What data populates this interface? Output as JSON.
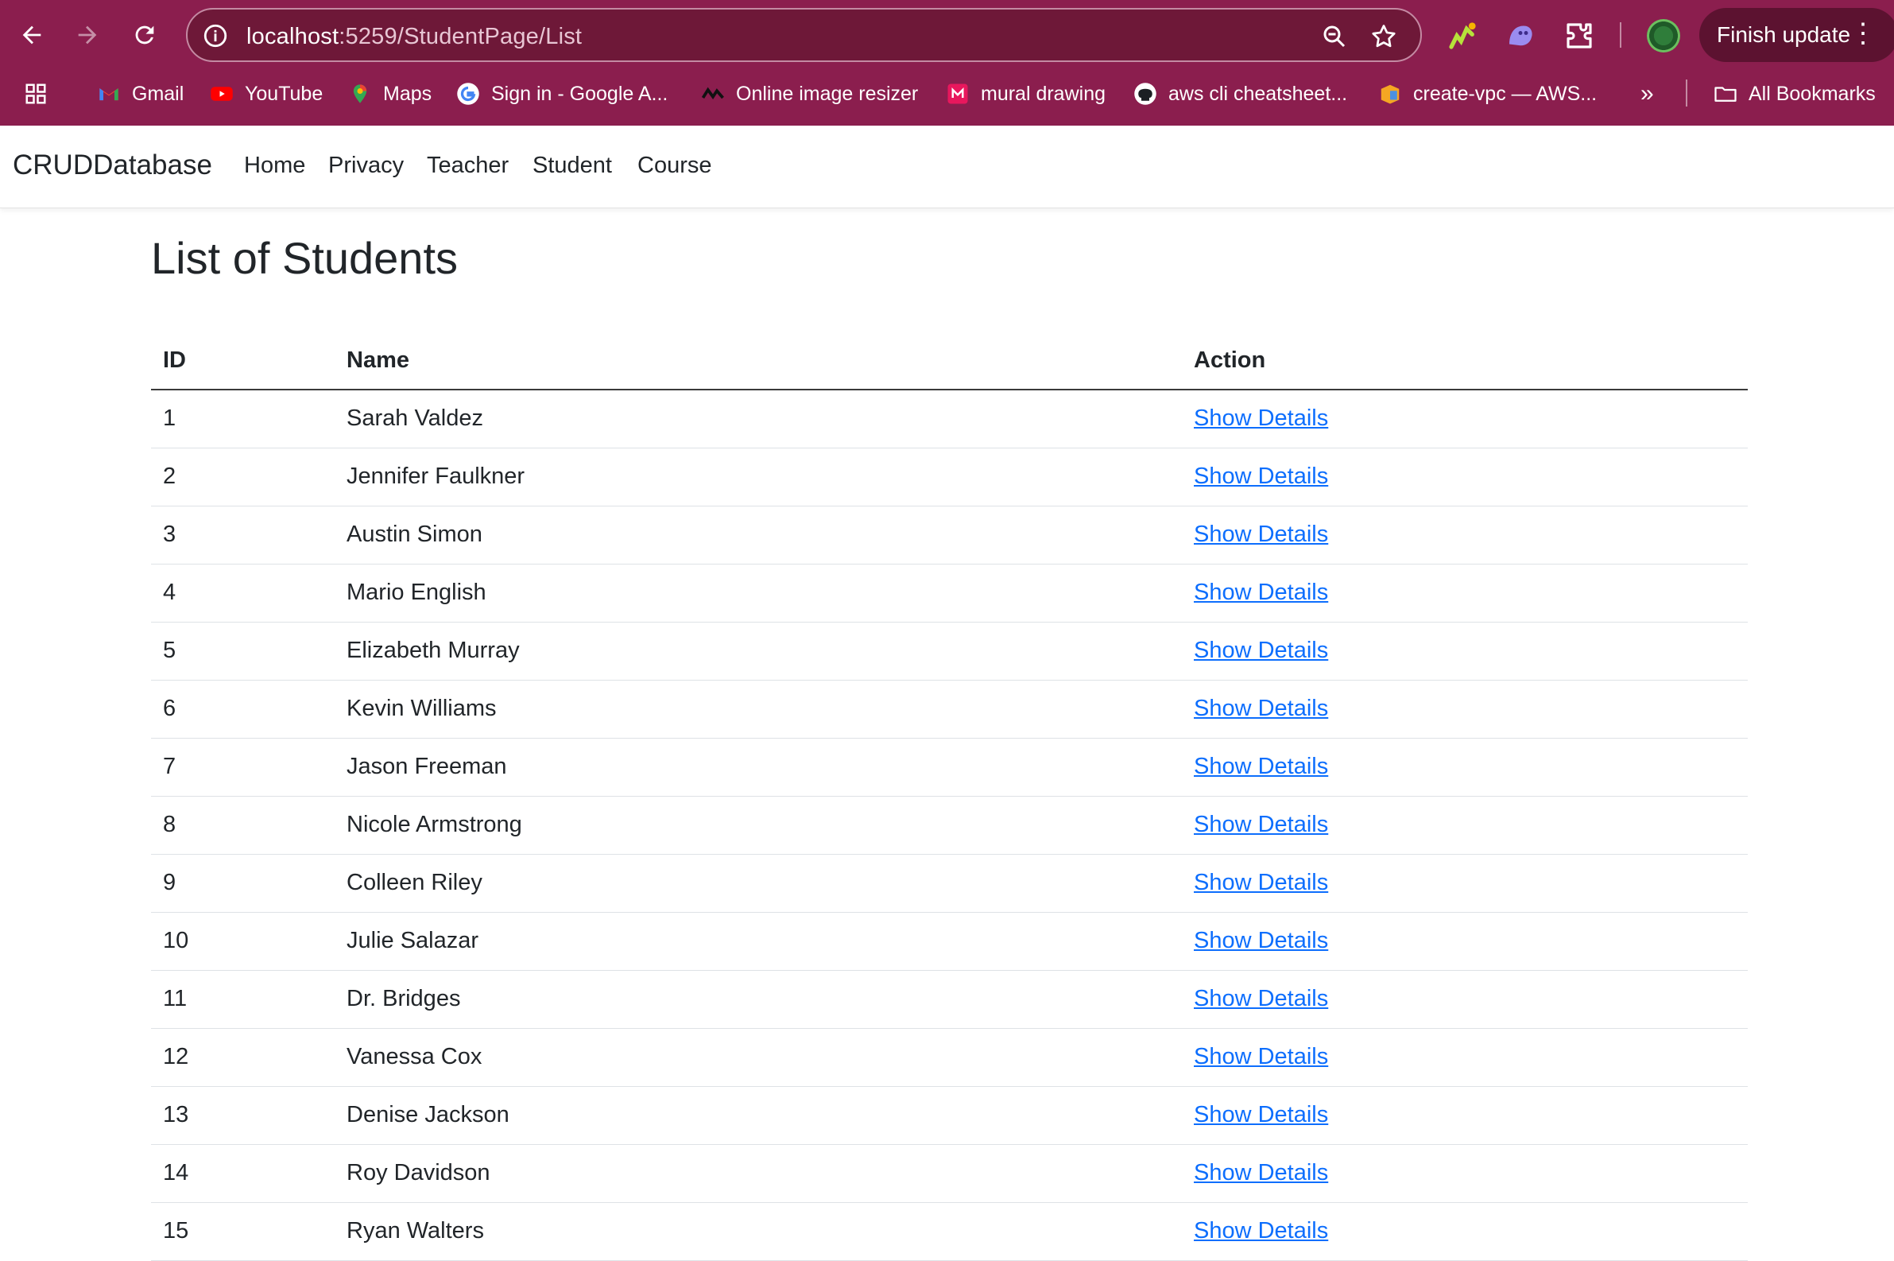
{
  "browser": {
    "url_host": "localhost",
    "url_rest": ":5259/StudentPage/List",
    "finish_update_label": "Finish update",
    "bookmarks": [
      {
        "label": "Gmail",
        "icon": "gmail-icon"
      },
      {
        "label": "YouTube",
        "icon": "youtube-icon"
      },
      {
        "label": "Maps",
        "icon": "maps-icon"
      },
      {
        "label": "Sign in - Google A...",
        "icon": "google-icon"
      },
      {
        "label": "Online image resizer",
        "icon": "resizer-icon"
      },
      {
        "label": "mural drawing",
        "icon": "mural-icon"
      },
      {
        "label": "aws cli cheatsheet...",
        "icon": "github-icon"
      },
      {
        "label": "create-vpc — AWS...",
        "icon": "aws-icon"
      }
    ],
    "more_bookmarks_label": "»",
    "all_bookmarks_label": "All Bookmarks",
    "colors": {
      "frame": "#8b1e4e",
      "omnibox": "#6e1838",
      "link": "#0d6efd"
    }
  },
  "app": {
    "brand": "CRUDDatabase",
    "nav": [
      "Home",
      "Privacy",
      "Teacher",
      "Student",
      "Course"
    ]
  },
  "page": {
    "title": "List of Students",
    "table": {
      "headers": [
        "ID",
        "Name",
        "Action"
      ],
      "rows": [
        {
          "id": "1",
          "name": "Sarah Valdez",
          "action": "Show Details"
        },
        {
          "id": "2",
          "name": "Jennifer Faulkner",
          "action": "Show Details"
        },
        {
          "id": "3",
          "name": "Austin Simon",
          "action": "Show Details"
        },
        {
          "id": "4",
          "name": "Mario English",
          "action": "Show Details"
        },
        {
          "id": "5",
          "name": "Elizabeth Murray",
          "action": "Show Details"
        },
        {
          "id": "6",
          "name": "Kevin Williams",
          "action": "Show Details"
        },
        {
          "id": "7",
          "name": "Jason Freeman",
          "action": "Show Details"
        },
        {
          "id": "8",
          "name": "Nicole Armstrong",
          "action": "Show Details"
        },
        {
          "id": "9",
          "name": "Colleen Riley",
          "action": "Show Details"
        },
        {
          "id": "10",
          "name": "Julie Salazar",
          "action": "Show Details"
        },
        {
          "id": "11",
          "name": "Dr. Bridges",
          "action": "Show Details"
        },
        {
          "id": "12",
          "name": "Vanessa Cox",
          "action": "Show Details"
        },
        {
          "id": "13",
          "name": "Denise Jackson",
          "action": "Show Details"
        },
        {
          "id": "14",
          "name": "Roy Davidson",
          "action": "Show Details"
        },
        {
          "id": "15",
          "name": "Ryan Walters",
          "action": "Show Details"
        }
      ]
    }
  }
}
